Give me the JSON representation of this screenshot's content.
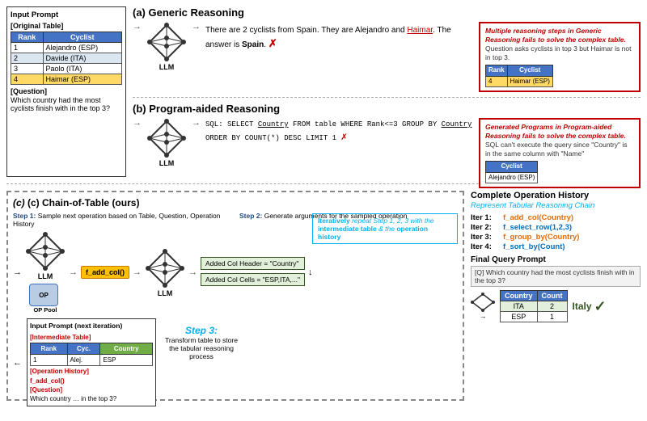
{
  "inputPrompt": {
    "title": "Input Prompt",
    "origTableLabel": "[Original Table]",
    "tableHeaders": [
      "Rank",
      "Cyclist"
    ],
    "tableRows": [
      [
        "1",
        "Alejandro (ESP)"
      ],
      [
        "2",
        "Davide (ITA)"
      ],
      [
        "3",
        "Paolo (ITA)"
      ],
      [
        "4",
        "Haimar (ESP)"
      ]
    ],
    "questionLabel": "[Question]",
    "questionText": "Which country had the most cyclists finish with in the top 3?"
  },
  "genericReasoning": {
    "title": "(a) Generic Reasoning",
    "reasoningText": "There are 2 cyclists from Spain. They are Alejandro and Haimar. The answer is Spain.",
    "crossMark": "✗",
    "errorTitle": "Multiple reasoning steps in Generic Reasoning fails to solve the complex table.",
    "errorBody": "Question asks cyclists in top 3 but Haimar is not in top 3.",
    "errorTableHeaders": [
      "Rank",
      "Cyclist"
    ],
    "errorTableRows": [
      [
        "4",
        "Haimar (ESP)"
      ]
    ]
  },
  "programAided": {
    "title": "(b) Program-aided Reasoning",
    "sqlText": "SQL: SELECT Country FROM table WHERE Rank<=3 GROUP BY Country ORDER BY COUNT(*) DESC LIMIT 1",
    "crossMark": "✗",
    "errorTitle": "Generated Programs in Program-aided Reasoning fails to solve the complex table.",
    "errorBody": "SQL can't execute the query since \"Country\" is in the same column with \"Name\"",
    "errorTableLabel": "Cyclist",
    "errorCellValue": "Alejandro (ESP)"
  },
  "chainOfTable": {
    "title": "(c) Chain-of-Table (ours)",
    "step1Title": "Step 1: Sample next operation based on Table, Question, Operation History",
    "step2Title": "Step 2: Generate arguments for the sampled operation",
    "step3Title": "Step 3:",
    "step3Body": "Transform table to store the tabular reasoning process",
    "funcName": "f_add_col()",
    "addedColHeader": "Added Col Header = \"Country\"",
    "addedColCells": "Added Col Cells = \"ESP,ITA,...\"",
    "iterPromptLabel": "[Intermediate Table]",
    "iterTableHeaders": [
      "Rank",
      "Cyc.",
      "Country"
    ],
    "iterTableRows": [
      [
        "1",
        "Alej.",
        "ESP"
      ]
    ],
    "opHistLabel": "[Operation History]",
    "opHistValue": "f_add_col()",
    "questionLabel": "[Question]",
    "questionText": "Which country … in the top 3?",
    "opPoolLabel": "OP Pool",
    "iterativeRepeat": "Iteratively repeat Step 1, 2, 3 with the intermediate table & the operation history"
  },
  "operationHistory": {
    "title": "Complete Operation History",
    "subtitle": "Represent Tabular Reasoning Chain",
    "iters": [
      {
        "label": "Iter 1:",
        "func": "f_add_col(Country)"
      },
      {
        "label": "Iter 2:",
        "func": "f_select_row(1,2,3)"
      },
      {
        "label": "Iter 3:",
        "func": "f_group_by(Country)"
      },
      {
        "label": "Iter 4:",
        "func": "f_sort_by(Count)"
      }
    ],
    "finalQueryTitle": "Final Query Prompt",
    "finalQueryText": "[Q] Which country had the most cyclists finish with in the top 3?",
    "resultTableHeaders": [
      "Country",
      "Count"
    ],
    "resultTableRows": [
      {
        "country": "ITA",
        "count": "2",
        "highlight": true
      },
      {
        "country": "ESP",
        "count": "1",
        "highlight": false
      }
    ],
    "answer": "Italy",
    "checkMark": "✓"
  }
}
